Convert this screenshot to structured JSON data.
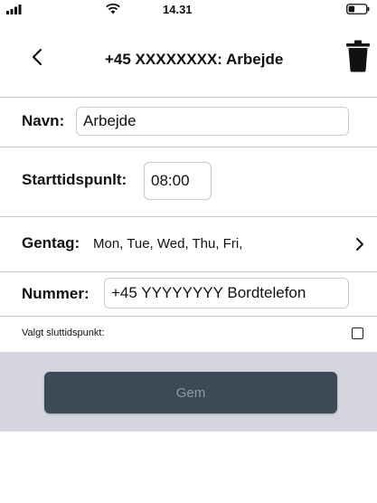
{
  "status_bar": {
    "time": "14.31"
  },
  "nav": {
    "title": "+45 XXXXXXXX: Arbejde",
    "back_icon": "chevron-left-icon",
    "delete_icon": "trash-icon"
  },
  "form": {
    "name_label": "Navn:",
    "name_value": "Arbejde",
    "start_label": "Starttidspunlt:",
    "start_value": "08:00",
    "repeat_label": "Gentag:",
    "repeat_value": "Mon, Tue, Wed, Thu, Fri,",
    "number_label": "Nummer:",
    "number_value": "+45 YYYYYYYY Bordtelefon",
    "end_time_label": "Valgt sluttidspunkt:",
    "end_time_checked": false
  },
  "footer": {
    "save_label": "Gem"
  },
  "colors": {
    "button_bg": "#3b4a56",
    "button_text": "#8f9aa6",
    "footer_bg": "#d3d4de",
    "divider": "#c8c8c8"
  }
}
